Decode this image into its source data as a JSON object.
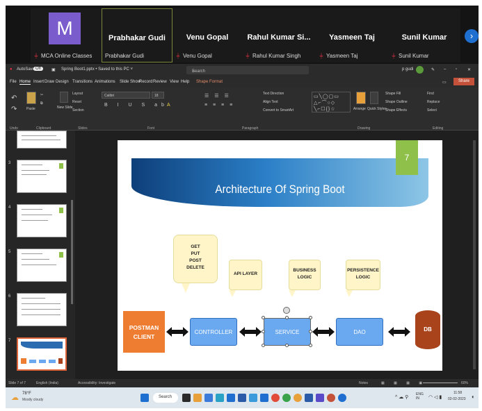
{
  "meeting": {
    "participants": [
      {
        "name": "",
        "label": "MCA Online Classes",
        "avatar_letter": "M"
      },
      {
        "name": "Prabhakar Gudi",
        "label": "Prabhakar Gudi"
      },
      {
        "name": "Venu Gopal",
        "label": "Venu Gopal"
      },
      {
        "name": "Rahul Kumar Si...",
        "label": "Rahul Kumar Singh"
      },
      {
        "name": "Yasmeen Taj",
        "label": "Yasmeen Taj"
      },
      {
        "name": "Sunil Kumar",
        "label": "Sunil Kumar"
      }
    ],
    "next_icon": "chevron-right-icon"
  },
  "titlebar": {
    "autosave": "AutoSave",
    "autosave_state": "Off",
    "filename": "Spring Boot1.pptx • Saved to this PC ˅",
    "search_placeholder": "Search",
    "user": "p gudi"
  },
  "menu": [
    "File",
    "Home",
    "Insert",
    "Draw",
    "Design",
    "Transitions",
    "Animations",
    "Slide Show",
    "Record",
    "Review",
    "View",
    "Help",
    "Shape Format"
  ],
  "share_label": "Share",
  "ribbon": {
    "groups": [
      "Undo",
      "Clipboard",
      "Slides",
      "Font",
      "Paragraph",
      "Drawing",
      "Editing"
    ],
    "paste": "Paste",
    "new_slide": "New Slide",
    "layout": "Layout",
    "reset": "Reset",
    "section": "Section",
    "font_name": "Calibri",
    "font_size": "18",
    "text_direction": "Text Direction",
    "align_text": "Align Text",
    "smartart": "Convert to SmartArt",
    "arrange": "Arrange",
    "quick_styles": "Quick Styles",
    "shape_fill": "Shape Fill",
    "shape_outline": "Shape Outline",
    "shape_effects": "Shape Effects",
    "find": "Find",
    "replace": "Replace",
    "select": "Select"
  },
  "thumbnails": [
    "3",
    "4",
    "5",
    "6",
    "7"
  ],
  "slide": {
    "number": "7",
    "title": "Architecture Of Spring Boot",
    "callout_methods": [
      "GET",
      "PUT",
      "POST",
      "DELETE"
    ],
    "callout_api": "API LAYER",
    "callout_business": "BUSINESS LOGIC",
    "callout_persistence": "PERSISTENCE LOGIC",
    "postman": "POSTMAN CLIENT",
    "controller": "CONTROLLER",
    "service": "SERVICE",
    "dao": "DAO",
    "db": "DB"
  },
  "status": {
    "slide_of": "Slide 7 of 7",
    "language": "English (India)",
    "accessibility": "Accessibility: Investigate",
    "notes": "Notes",
    "zoom": "60%"
  },
  "taskbar": {
    "weather_temp": "78°F",
    "weather_desc": "Mostly cloudy",
    "search": "Search",
    "lang": "ENG IN",
    "time": "11:58",
    "date": "02-02-2023"
  }
}
